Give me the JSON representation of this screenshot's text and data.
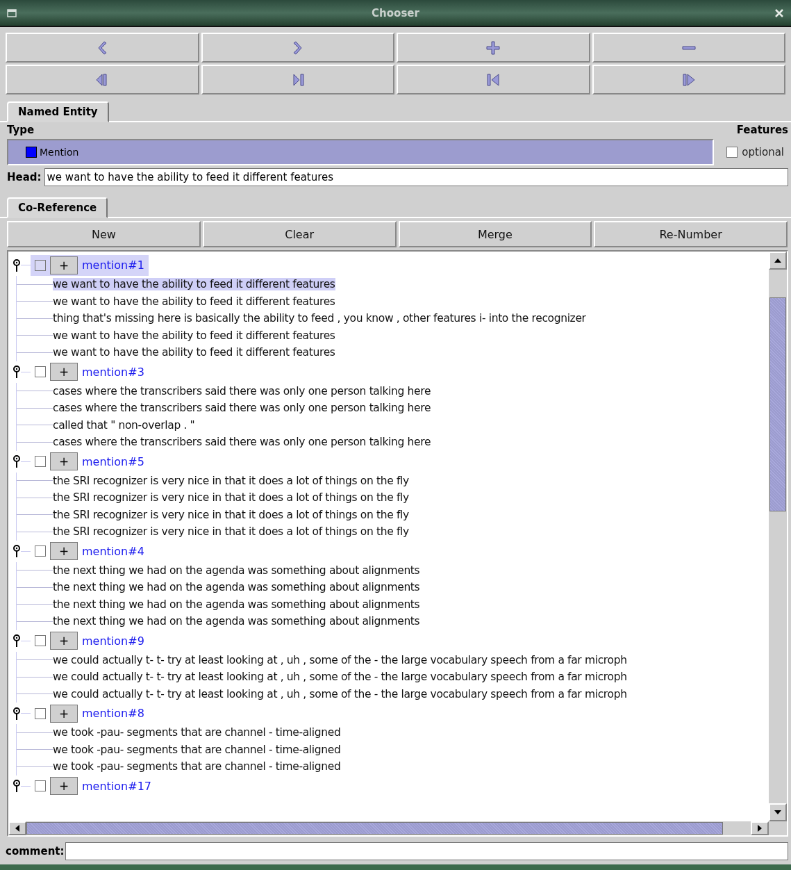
{
  "window": {
    "title": "Chooser"
  },
  "nav_buttons": [
    {
      "kind": "prev"
    },
    {
      "kind": "next"
    },
    {
      "kind": "add"
    },
    {
      "kind": "remove"
    },
    {
      "kind": "first"
    },
    {
      "kind": "last"
    },
    {
      "kind": "back"
    },
    {
      "kind": "forward"
    }
  ],
  "named_entity": {
    "tab": {
      "label": "Named Entity",
      "selected": true
    },
    "type_label": "Type",
    "features_label": "Features",
    "type_items": [
      {
        "label": "Mention",
        "color": "#0000ff",
        "selected": true
      }
    ],
    "optional": {
      "label": "optional",
      "checked": false
    },
    "head": {
      "label": "Head:",
      "value": "we want to have the ability to feed it different features"
    }
  },
  "co_reference": {
    "tab": {
      "label": "Co-Reference",
      "selected": true
    },
    "buttons": [
      "New",
      "Clear",
      "Merge",
      "Re-Number"
    ],
    "tree": [
      {
        "label": "mention#1",
        "selected": true,
        "checked": false,
        "children": [
          {
            "text": "we want to have the ability to feed it different features",
            "selected": true
          },
          {
            "text": "we want to have the ability to feed it different features",
            "selected": false
          },
          {
            "text": "thing that's missing here is basically the ability to feed , you know , other features i- into the recognizer",
            "selected": false
          },
          {
            "text": "we want to have the ability to feed it different features",
            "selected": false
          },
          {
            "text": "we want to have the ability to feed it different features",
            "selected": false
          }
        ]
      },
      {
        "label": "mention#3",
        "selected": false,
        "checked": false,
        "children": [
          {
            "text": "cases where the transcribers said there was only one person talking here",
            "selected": false
          },
          {
            "text": "cases where the transcribers said there was only one person talking here",
            "selected": false
          },
          {
            "text": "called that \" non-overlap . \"",
            "selected": false
          },
          {
            "text": "cases where the transcribers said there was only one person talking here",
            "selected": false
          }
        ]
      },
      {
        "label": "mention#5",
        "selected": false,
        "checked": false,
        "children": [
          {
            "text": "the SRI recognizer is very nice in that it does a lot of things on the fly",
            "selected": false
          },
          {
            "text": "the SRI recognizer is very nice in that it does a lot of things on the fly",
            "selected": false
          },
          {
            "text": "the SRI recognizer is very nice in that it does a lot of things on the fly",
            "selected": false
          },
          {
            "text": "the SRI recognizer is very nice in that it does a lot of things on the fly",
            "selected": false
          }
        ]
      },
      {
        "label": "mention#4",
        "selected": false,
        "checked": false,
        "children": [
          {
            "text": "the next thing we had on the agenda was something about alignments",
            "selected": false
          },
          {
            "text": "the next thing we had on the agenda was something about alignments",
            "selected": false
          },
          {
            "text": "the next thing we had on the agenda was something about alignments",
            "selected": false
          },
          {
            "text": "the next thing we had on the agenda was something about alignments",
            "selected": false
          }
        ]
      },
      {
        "label": "mention#9",
        "selected": false,
        "checked": false,
        "children": [
          {
            "text": "we could actually t- t- try at least looking at , uh , some of the - the large vocabulary speech from a far microph",
            "selected": false
          },
          {
            "text": "we could actually t- t- try at least looking at , uh , some of the - the large vocabulary speech from a far microph",
            "selected": false
          },
          {
            "text": "we could actually t- t- try at least looking at , uh , some of the - the large vocabulary speech from a far microph",
            "selected": false
          }
        ]
      },
      {
        "label": "mention#8",
        "selected": false,
        "checked": false,
        "children": [
          {
            "text": "we took -pau- segments that are channel - time-aligned",
            "selected": false
          },
          {
            "text": "we took -pau- segments that are channel - time-aligned",
            "selected": false
          },
          {
            "text": "we took -pau- segments that are channel - time-aligned",
            "selected": false
          }
        ]
      },
      {
        "label": "mention#17",
        "selected": false,
        "checked": false
      }
    ]
  },
  "comment": {
    "label": "comment:"
  },
  "plus_label": "+"
}
